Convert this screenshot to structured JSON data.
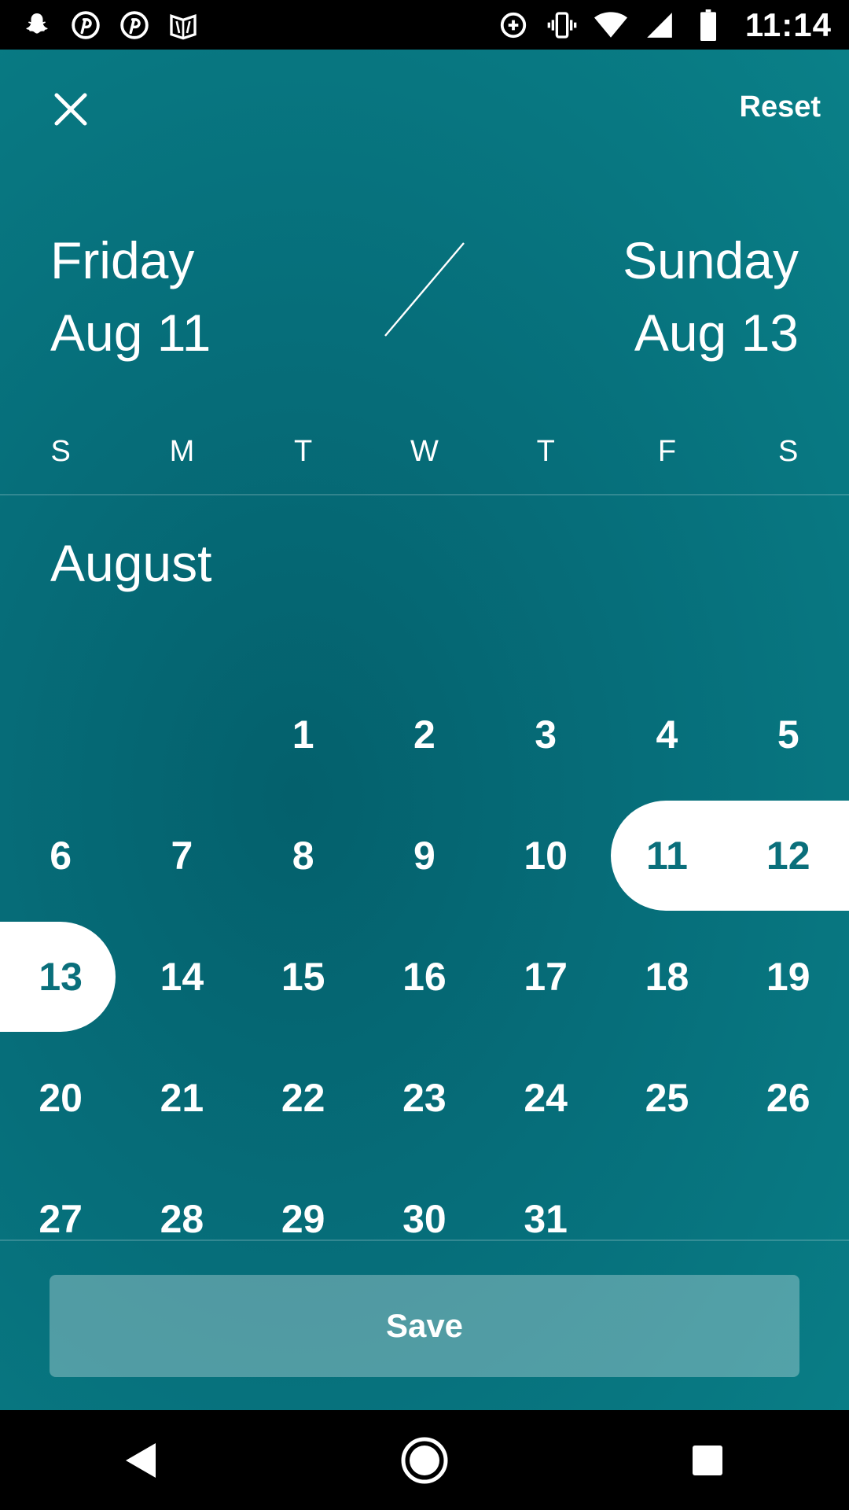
{
  "status_bar": {
    "time": "11:14",
    "left_icons": [
      "snapchat-icon",
      "pinterest-icon",
      "pinterest-icon",
      "feedly-icon"
    ],
    "right_icons": [
      "data-saver-icon",
      "vibrate-icon",
      "wifi-icon",
      "signal-icon",
      "battery-icon"
    ]
  },
  "header": {
    "close_icon": "close-icon",
    "reset_label": "Reset"
  },
  "range": {
    "start_day": "Friday",
    "start_date": "Aug 11",
    "end_day": "Sunday",
    "end_date": "Aug 13"
  },
  "weekdays": [
    "S",
    "M",
    "T",
    "W",
    "T",
    "F",
    "S"
  ],
  "calendar": {
    "month": "August",
    "weeks": [
      [
        "",
        "",
        "1",
        "2",
        "3",
        "4",
        "5"
      ],
      [
        "6",
        "7",
        "8",
        "9",
        "10",
        "11",
        "12"
      ],
      [
        "13",
        "14",
        "15",
        "16",
        "17",
        "18",
        "19"
      ],
      [
        "20",
        "21",
        "22",
        "23",
        "24",
        "25",
        "26"
      ],
      [
        "27",
        "28",
        "29",
        "30",
        "31",
        "",
        ""
      ]
    ],
    "selected": [
      "11",
      "12",
      "13"
    ]
  },
  "footer": {
    "save_label": "Save"
  },
  "nav_bar": {
    "icons": [
      "back-icon",
      "home-icon",
      "recents-icon"
    ]
  },
  "colors": {
    "accent": "#0a6f7b",
    "background": "#066e7a"
  }
}
